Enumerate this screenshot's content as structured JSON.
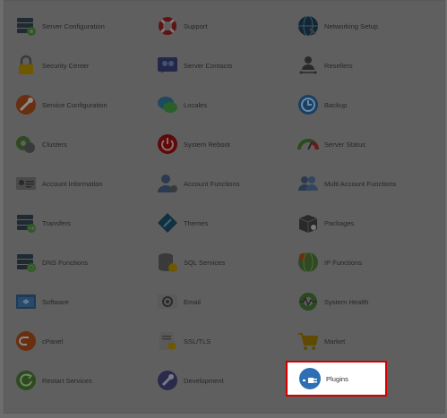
{
  "items": [
    {
      "label": "Server Configuration",
      "icon": "server-configuration-icon"
    },
    {
      "label": "Support",
      "icon": "support-lifebuoy-icon"
    },
    {
      "label": "Networking Setup",
      "icon": "networking-setup-icon"
    },
    {
      "label": "Security Center",
      "icon": "padlock-icon"
    },
    {
      "label": "Server Contacts",
      "icon": "server-contacts-icon"
    },
    {
      "label": "Resellers",
      "icon": "resellers-icon"
    },
    {
      "label": "Service Configuration",
      "icon": "service-configuration-icon"
    },
    {
      "label": "Locales",
      "icon": "locales-icon"
    },
    {
      "label": "Backup",
      "icon": "backup-icon"
    },
    {
      "label": "Clusters",
      "icon": "clusters-icon"
    },
    {
      "label": "System Reboot",
      "icon": "power-icon"
    },
    {
      "label": "Server Status",
      "icon": "gauge-icon"
    },
    {
      "label": "Account Information",
      "icon": "account-information-icon"
    },
    {
      "label": "Account Functions",
      "icon": "account-functions-icon"
    },
    {
      "label": "Multi Account Functions",
      "icon": "multi-account-functions-icon"
    },
    {
      "label": "Transfers",
      "icon": "transfers-icon"
    },
    {
      "label": "Themes",
      "icon": "themes-icon"
    },
    {
      "label": "Packages",
      "icon": "packages-icon"
    },
    {
      "label": "DNS Functions",
      "icon": "dns-functions-icon"
    },
    {
      "label": "SQL Services",
      "icon": "database-icon"
    },
    {
      "label": "IP Functions",
      "icon": "ip-functions-icon"
    },
    {
      "label": "Software",
      "icon": "software-icon"
    },
    {
      "label": "Email",
      "icon": "email-icon"
    },
    {
      "label": "System Health",
      "icon": "system-health-icon"
    },
    {
      "label": "cPanel",
      "icon": "cpanel-icon"
    },
    {
      "label": "SSL/TLS",
      "icon": "ssl-tls-icon"
    },
    {
      "label": "Market",
      "icon": "shopping-cart-icon"
    },
    {
      "label": "Restart Services",
      "icon": "restart-icon"
    },
    {
      "label": "Development",
      "icon": "development-icon"
    },
    {
      "label": "Plugins",
      "icon": "plug-icon"
    }
  ],
  "colors": {
    "overlay": "#5f5f5f",
    "highlight_border": "#d40000",
    "highlight_background": "#ffffff"
  }
}
